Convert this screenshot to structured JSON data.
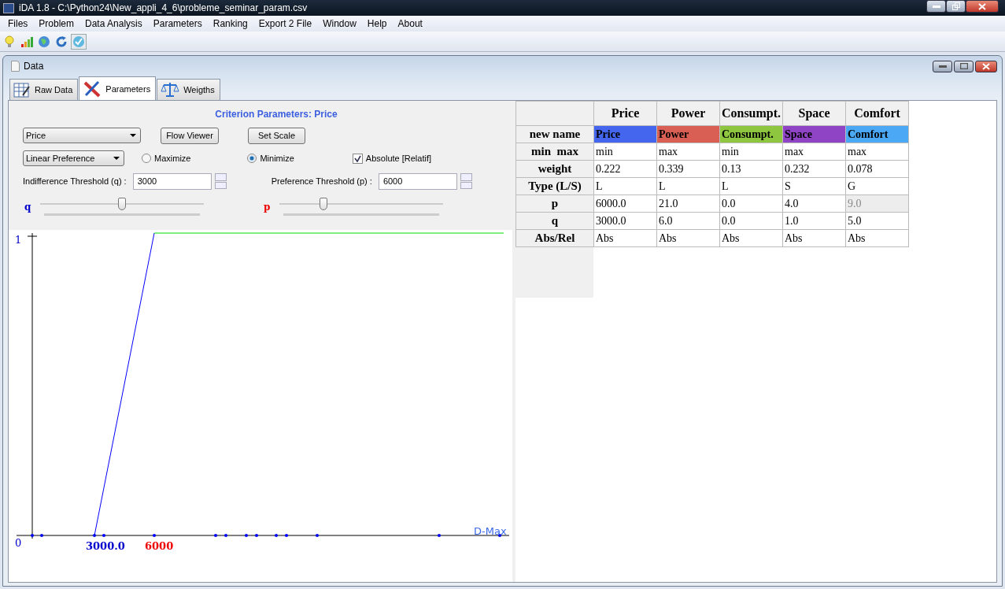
{
  "window": {
    "title": "iDA 1.8 - C:\\Python24\\New_appli_4_6\\probleme_seminar_param.csv"
  },
  "menu": [
    {
      "label": "Files"
    },
    {
      "label": "Problem"
    },
    {
      "label": "Data Analysis"
    },
    {
      "label": "Parameters"
    },
    {
      "label": "Ranking"
    },
    {
      "label": "Export 2 File"
    },
    {
      "label": "Window"
    },
    {
      "label": "Help"
    },
    {
      "label": "About"
    }
  ],
  "toolbar": [
    {
      "kind": "bulb",
      "selected": false
    },
    {
      "kind": "bars",
      "selected": false
    },
    {
      "kind": "globe",
      "selected": false
    },
    {
      "kind": "refresh",
      "selected": false
    },
    {
      "kind": "check",
      "selected": true
    }
  ],
  "child_window": {
    "title": "Data"
  },
  "tabs": [
    {
      "label": "Raw Data",
      "kind": "table",
      "selected": false
    },
    {
      "label": "Parameters",
      "kind": "tools",
      "selected": true
    },
    {
      "label": "Weigths",
      "kind": "scale",
      "selected": false
    }
  ],
  "panel": {
    "heading": "Criterion Parameters: Price",
    "criterion_select": "Price",
    "flow_button": "Flow Viewer",
    "scale_button": "Set Scale",
    "preference_select": "Linear Preference",
    "direction": [
      {
        "label": "Maximize",
        "selected": false
      },
      {
        "label": "Minimize",
        "selected": true
      }
    ],
    "absolute": {
      "label": "Absolute [Relatif]",
      "checked": true
    },
    "thresholds": [
      {
        "label": "Indifference Threshold (q) :",
        "value": "3000",
        "slider_label": "q",
        "level": 0.5
      },
      {
        "label": "Preference Threshold (p) :",
        "value": "6000",
        "slider_label": "p",
        "level": 0.27
      }
    ]
  },
  "plot": {
    "y_label": "1",
    "origin_label": "0",
    "q_label": "3000.0",
    "p_label": "6000",
    "x_label": "D-Max"
  },
  "table": {
    "columns": [
      "Price",
      "Power",
      "Consumpt.",
      "Space",
      "Comfort"
    ],
    "rows": [
      {
        "label": "new name",
        "cells": [
          {
            "text": "Price",
            "color": "#4466ee"
          },
          {
            "text": "Power",
            "color": "#d95f55"
          },
          {
            "text": "Consumpt.",
            "color": "#8ec63f"
          },
          {
            "text": "Space",
            "color": "#8e44c4"
          },
          {
            "text": "Comfort",
            "color": "#4aa8f5"
          }
        ]
      },
      {
        "label": "min  max",
        "cells": [
          "min",
          "max",
          "min",
          "max",
          "max"
        ]
      },
      {
        "label": "weight",
        "cells": [
          "0.222",
          "0.339",
          "0.13",
          "0.232",
          "0.078"
        ]
      },
      {
        "label": "Type (L/S)",
        "cells": [
          "L",
          "L",
          "L",
          "S",
          "G"
        ]
      },
      {
        "label": "p",
        "cells": [
          {
            "text": "6000.0",
            "disabled": false
          },
          {
            "text": "21.0",
            "disabled": false
          },
          {
            "text": "0.0",
            "disabled": false
          },
          {
            "text": "4.0",
            "disabled": false
          },
          {
            "text": "9.0",
            "disabled": true
          }
        ]
      },
      {
        "label": "q",
        "cells": [
          "3000.0",
          "6.0",
          "0.0",
          "1.0",
          "5.0"
        ]
      },
      {
        "label": "Abs/Rel",
        "cells": [
          "Abs",
          "Abs",
          "Abs",
          "Abs",
          "Abs"
        ]
      }
    ]
  }
}
